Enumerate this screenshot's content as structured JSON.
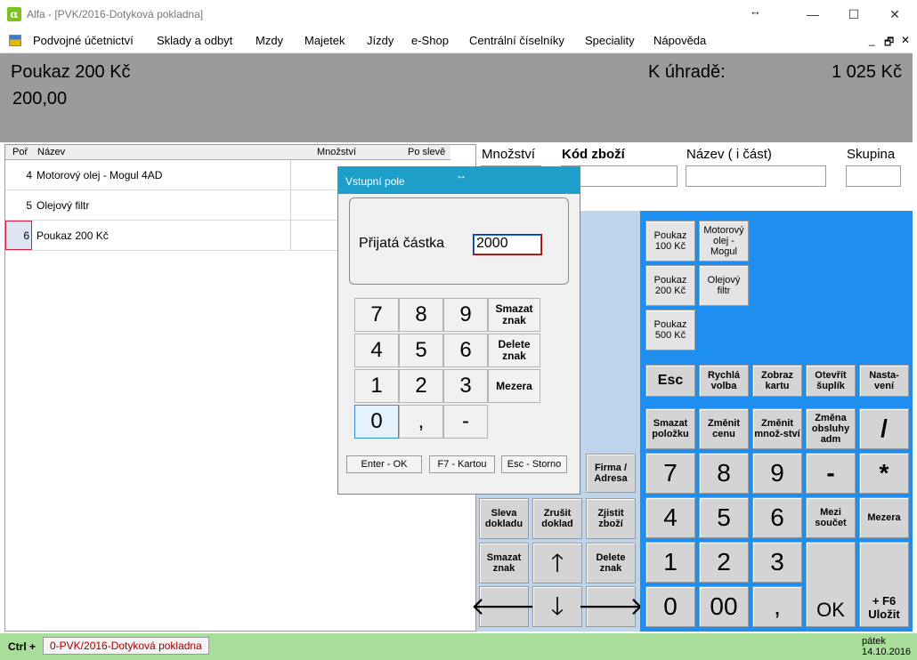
{
  "window": {
    "app_letter": "α",
    "title": "Alfa - [PVK/2016-Dotyková pokladna]",
    "resize_glyph": "↔",
    "minimize": "—",
    "maximize": "☐",
    "close": "✕"
  },
  "menu": {
    "items": [
      "Podvojné účetnictví",
      "Sklady a odbyt",
      "Mzdy",
      "Majetek",
      "Jízdy",
      "e-Shop",
      "Centrální číselníky",
      "Speciality",
      "Nápověda"
    ],
    "child_controls": [
      "_",
      "🗗",
      "✕"
    ]
  },
  "header": {
    "item_name": "Poukaz 200 Kč",
    "item_price": "200,00",
    "due_label": "K úhradě:",
    "due_value": "1 025 Kč"
  },
  "grid": {
    "columns": [
      "Poř",
      "Název",
      "Množství",
      "Po slevě"
    ],
    "rows": [
      {
        "no": "4",
        "name": "Motorový olej - Mogul 4AD"
      },
      {
        "no": "5",
        "name": "Olejový filtr"
      },
      {
        "no": "6",
        "name": "Poukaz 200 Kč"
      }
    ]
  },
  "search": {
    "qty_label": "Množství",
    "code_label": "Kód zboží",
    "name_label": "Název ( i část)",
    "group_label": "Skupina"
  },
  "products": [
    {
      "label": "Poukaz 100 Kč",
      "color": "#a5d49b"
    },
    {
      "label": "Motorový olej - Mogul",
      "color": "#d4d4d4"
    },
    {
      "label": "Poukaz 200 Kč",
      "color": "#a5d49b"
    },
    {
      "label": "Olejový filtr",
      "color": "#d4d4d4"
    },
    {
      "label": "Poukaz 500 Kč",
      "color": "#a5d49b"
    }
  ],
  "keypad": {
    "esc": "Esc",
    "quick": "Rychlá volba",
    "show_card": "Zobraz kartu",
    "open_drawer": "Otevřít šuplík",
    "settings": "Nasta-vení",
    "delete_item": "Smazat položku",
    "change_price": "Změnit cenu",
    "change_qty": "Změnit množ-ství",
    "change_staff": "Změna obsluhy adm",
    "div": "/",
    "mul": "*",
    "minus": "-",
    "subtotal": "Mezi součet",
    "space": "Mezera",
    "ok": "OK",
    "save": "+ F6 Uložit",
    "d7": "7",
    "d8": "8",
    "d9": "9",
    "d4": "4",
    "d5": "5",
    "d6": "6",
    "d1": "1",
    "d2": "2",
    "d3": "3",
    "d0": "0",
    "d00": "00",
    "comma": ","
  },
  "left_keys": {
    "company": "Firma / Adresa",
    "discount": "Sleva dokladu",
    "cancel_doc": "Zrušit doklad",
    "find_item": "Zjistit zboží",
    "del_char": "Smazat znak",
    "delete_char": "Delete znak",
    "up": "🡑",
    "down": "🡓",
    "left": "🡐",
    "right": "🡒"
  },
  "dialog": {
    "title": "Vstupní pole",
    "resize_glyph": "↔",
    "field_label": "Přijatá částka",
    "field_value": "2000",
    "keys": {
      "k7": "7",
      "k8": "8",
      "k9": "9",
      "k4": "4",
      "k5": "5",
      "k6": "6",
      "k1": "1",
      "k2": "2",
      "k3": "3",
      "k0": "0",
      "comma": ",",
      "minus": "-",
      "del": "Smazat znak",
      "delete": "Delete znak",
      "space": "Mezera"
    },
    "enter_ok": "Enter - OK",
    "f7_card": "F7 - Kartou",
    "esc_cancel": "Esc - Storno"
  },
  "status": {
    "ctrl": "Ctrl +",
    "tab": "0-PVK/2016-Dotyková pokladna",
    "day": "pátek",
    "date": "14.10.2016"
  }
}
